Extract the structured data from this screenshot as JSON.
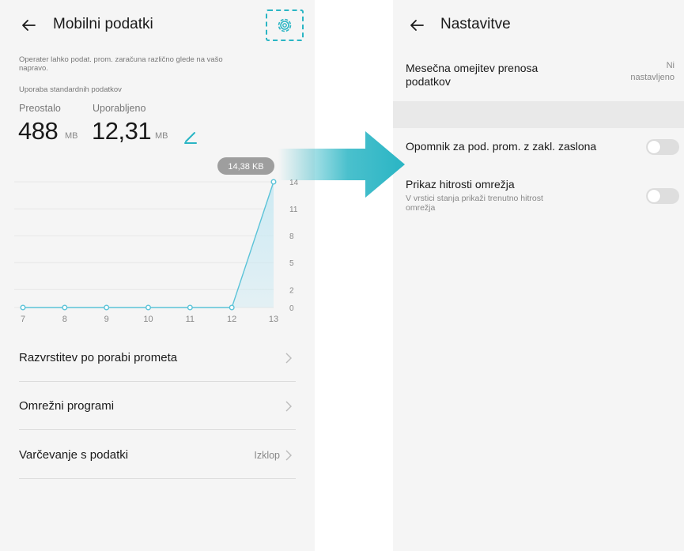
{
  "left": {
    "title": "Mobilni podatki",
    "note_line1": "Operater lahko podat. prom. zaračuna različno glede na vašo",
    "note_line2": "napravo.",
    "usage_label": "Uporaba standardnih podatkov",
    "remaining_label": "Preostalo",
    "remaining_value": "488",
    "remaining_unit": "MB",
    "used_label": "Uporabljeno",
    "used_value": "12,31",
    "used_unit": "MB",
    "rows": [
      {
        "label": "Razvrstitev po porabi prometa",
        "value": ""
      },
      {
        "label": "Omrežni programi",
        "value": ""
      },
      {
        "label": "Varčevanje s podatki",
        "value": "Izklop"
      }
    ]
  },
  "right": {
    "title": "Nastavitve",
    "monthly_limit_line1": "Mesečna omejitev prenosa",
    "monthly_limit_line2": "podatkov",
    "monthly_limit_value_line1": "Ni",
    "monthly_limit_value_line2": "nastavljeno",
    "lockscreen_reminder": "Opomnik za pod. prom. z zakl. zaslona",
    "network_speed_title": "Prikaz hitrosti omrežja",
    "network_speed_desc_line1": "V vrstici stanja prikaži trenutno hitrost",
    "network_speed_desc_line2": "omrežja",
    "lockscreen_reminder_on": false,
    "network_speed_on": false
  },
  "colors": {
    "accent": "#2ab5c4",
    "chart_line": "#5bc3d8",
    "chart_fill": "#cdeaf3"
  },
  "chart_data": {
    "type": "area",
    "x": [
      7,
      8,
      9,
      10,
      11,
      12,
      13
    ],
    "values": [
      0,
      0,
      0,
      0,
      0,
      0,
      14
    ],
    "y_ticks": [
      "14",
      "11",
      "8",
      "5",
      "2",
      "0"
    ],
    "ylim": [
      0,
      14
    ],
    "tooltip": "14,38 KB",
    "grid": true
  }
}
